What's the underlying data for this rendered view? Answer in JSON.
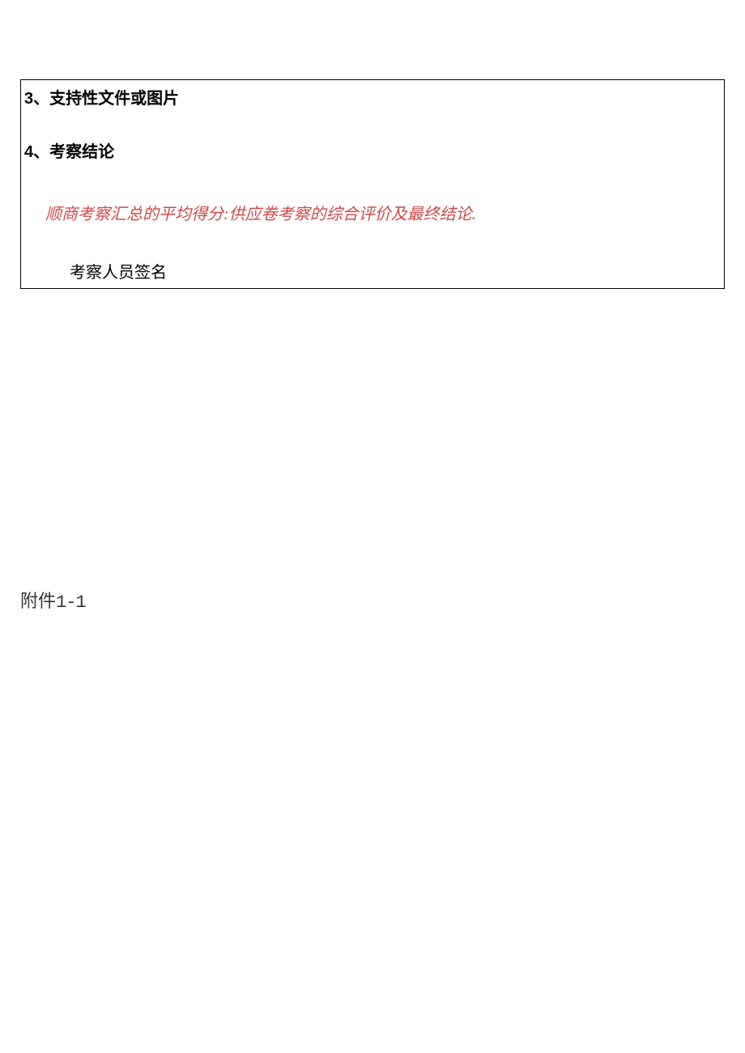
{
  "box": {
    "section3": {
      "number": "3",
      "separator": "、",
      "title": "支持性文件或图片"
    },
    "section4": {
      "number": "4",
      "separator": "、",
      "title": "考察结论"
    },
    "red_note": "顺商考察汇总的平均得分:供应卷考察的综合评价及最终结论.",
    "signature_label": "考察人员签名"
  },
  "attachment": {
    "prefix": "附件",
    "number": "1-1"
  }
}
